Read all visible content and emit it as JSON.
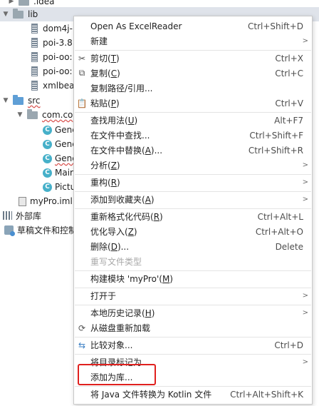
{
  "tree": {
    "idea": ".idea",
    "lib": "lib",
    "jars": [
      "dom4j-",
      "poi-3.8",
      "poi-oo:",
      "poi-oo:",
      "xmlbea"
    ],
    "src": "src",
    "pkg": "com.co",
    "classes": [
      "Gene",
      "Gene",
      "Gene",
      "Mair",
      "Pictu"
    ],
    "iml": "myPro.iml",
    "external_libs": "外部库",
    "scratches": "草稿文件和控制"
  },
  "menu": {
    "open_excel": "Open As ExcelReader",
    "open_excel_key": "Ctrl+Shift+D",
    "new": "新建",
    "cut": "剪切(",
    "cut_u": "T",
    "cut_end": ")",
    "cut_key": "Ctrl+X",
    "copy": "复制(",
    "copy_u": "C",
    "copy_end": ")",
    "copy_key": "Ctrl+C",
    "copy_path": "复制路径/引用...",
    "paste": "粘贴(",
    "paste_u": "P",
    "paste_end": ")",
    "paste_key": "Ctrl+V",
    "find_usages": "查找用法(",
    "find_usages_u": "U",
    "find_usages_end": ")",
    "find_usages_key": "Alt+F7",
    "find_in_files": "在文件中查找...",
    "find_in_files_key": "Ctrl+Shift+F",
    "replace_in_files": "在文件中替换(",
    "replace_in_files_u": "A",
    "replace_in_files_end": ")...",
    "replace_in_files_key": "Ctrl+Shift+R",
    "analyze": "分析(",
    "analyze_u": "Z",
    "analyze_end": ")",
    "refactor": "重构(",
    "refactor_u": "R",
    "refactor_end": ")",
    "add_favorites": "添加到收藏夹(",
    "add_favorites_u": "A",
    "add_favorites_end": ")",
    "reformat": "重新格式化代码(",
    "reformat_u": "R",
    "reformat_end": ")",
    "reformat_key": "Ctrl+Alt+L",
    "optimize_imports": "优化导入(",
    "optimize_imports_u": "Z",
    "optimize_imports_end": ")",
    "optimize_imports_key": "Ctrl+Alt+O",
    "delete": "删除(",
    "delete_u": "D",
    "delete_end": ")...",
    "delete_key": "Delete",
    "override_type": "重写文件类型",
    "build_module": "构建模块 'myPro'(",
    "build_module_u": "M",
    "build_module_end": ")",
    "open_in": "打开于",
    "local_history": "本地历史记录(",
    "local_history_u": "H",
    "local_history_end": ")",
    "reload_disk": "从磁盘重新加载",
    "compare": "比较对象...",
    "compare_key": "Ctrl+D",
    "mark_dir": "将目录标记为",
    "add_library": "添加为库...",
    "convert_kotlin": "将 Java 文件转换为 Kotlin 文件",
    "convert_kotlin_key": "Ctrl+Alt+Shift+K"
  },
  "colors": {
    "highlight_box": "#e0201e",
    "selection_row": "#dfe3ea"
  }
}
